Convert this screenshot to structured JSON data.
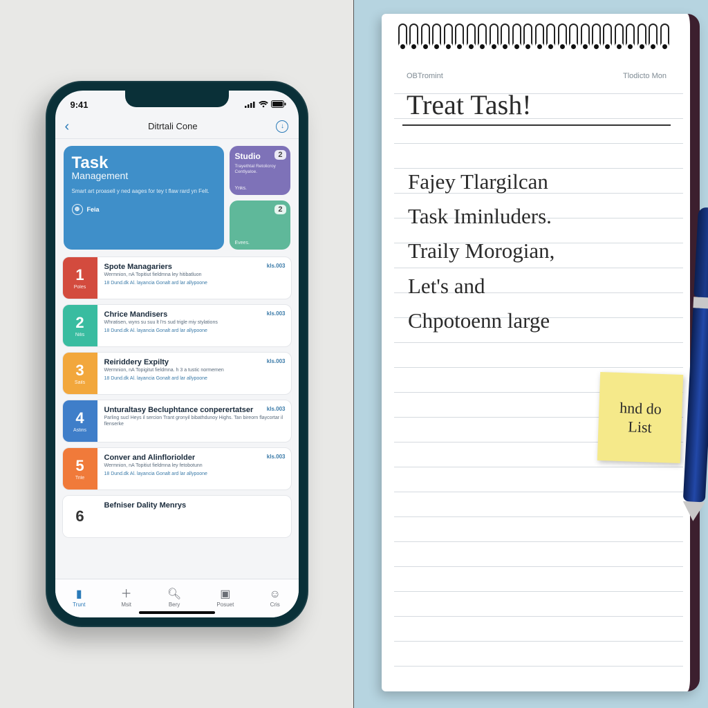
{
  "status": {
    "time": "9:41"
  },
  "nav": {
    "title": "Ditrtali Cone"
  },
  "hero": {
    "title": "Task",
    "subtitle": "Management",
    "desc": "Smart art proasell y ned aages for tey t flaw rard yn Felt.",
    "chip": "Feia"
  },
  "side": {
    "a": {
      "title": "Studio",
      "badge": "2",
      "desc": "Trayethtal Retolicroy Centlyaloe.",
      "foot": "Ynks."
    },
    "b": {
      "title": "",
      "badge": "2",
      "desc": "",
      "foot": "Evees."
    }
  },
  "rows": [
    {
      "num": "1",
      "numsub": "Poles",
      "title": "Spote Managariers",
      "tag": "kls.003",
      "desc": "Wermnion, nA Topitiut fieldmna ley hitibatluon",
      "meta": "18 Dund.dk Al. layancia Gonalt ard lar allypoone"
    },
    {
      "num": "2",
      "numsub": "Nilis",
      "title": "Chrice Mandisers",
      "tag": "kls.003",
      "desc": "Whratisen, wyns su suu lt l'rs sud trigle miy stylations",
      "meta": "18 Dund.dk Al. layancia Gonalt ard lar allypoone"
    },
    {
      "num": "3",
      "numsub": "Sails",
      "title": "Reiriddery Expilty",
      "tag": "kls.003",
      "desc": "Wermnion, nA Topigitut fieldmna. h 3 a tustic normemen",
      "meta": "18 Dund.dk Al. layancia Gonalt ard lar allypoone"
    },
    {
      "num": "4",
      "numsub": "Astins",
      "title": "Unturaltasy Becluphtance conperertatser",
      "tag": "kls.003",
      "desc": "Parling sucl Heys il sercion Trant gronyil bibathdunoy Highs. Tan bireorn flaycortar il flenserke",
      "meta": ""
    },
    {
      "num": "5",
      "numsub": "Trile",
      "title": "Conver and Alinfloriolder",
      "tag": "kls.003",
      "desc": "Wermnion, nA Topitiut fieldmna ley fetobotunn",
      "meta": "18 Dund.dk Al. layancia Gonalt ard lar allypoone"
    },
    {
      "num": "6",
      "numsub": "",
      "title": "Befniser Dality Menrys",
      "tag": "",
      "desc": "",
      "meta": ""
    }
  ],
  "tabs": [
    {
      "label": "Trunt"
    },
    {
      "label": "Msit"
    },
    {
      "label": "Bery"
    },
    {
      "label": "Posuet"
    },
    {
      "label": "Cris"
    }
  ],
  "notebook": {
    "header_left": "OBTromint",
    "header_right": "Tlodicto Mon",
    "title": "Treat Tash!",
    "body": "Fajey Tlargilcan\nTask Iminluders.\nTraily Morogian,\nLet's and\nChpotoenn large",
    "sticky": "hnd do\nList"
  }
}
